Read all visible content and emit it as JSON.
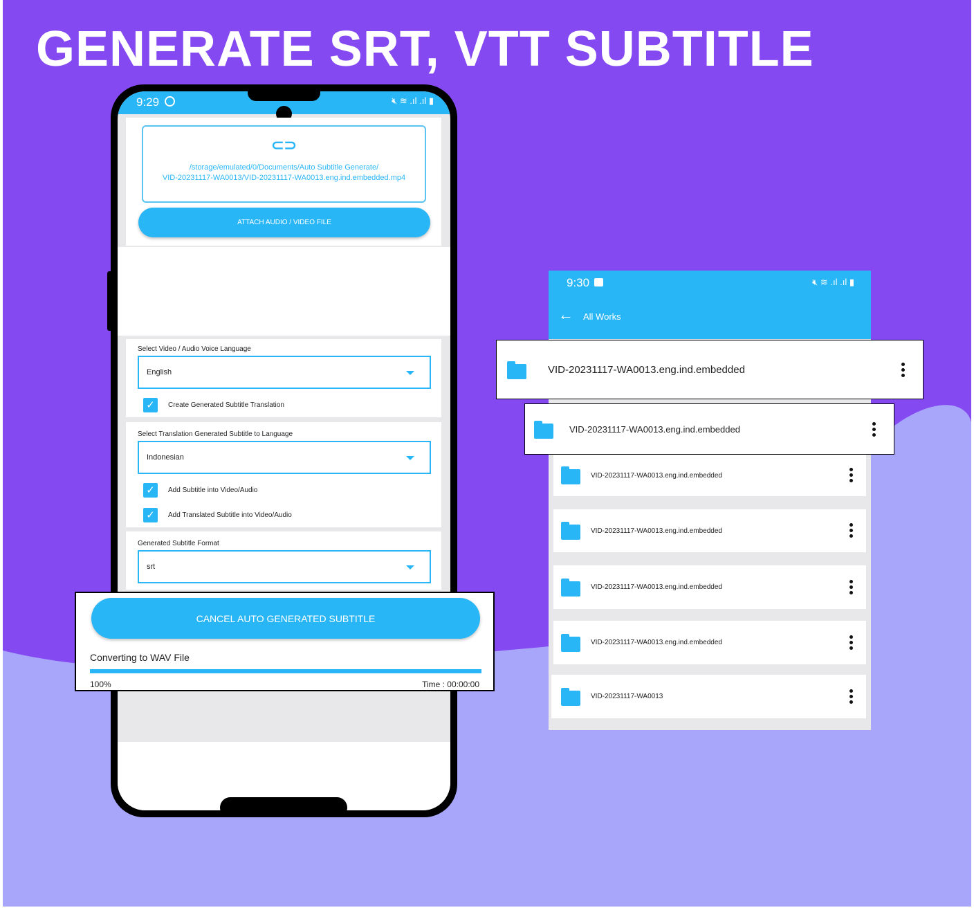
{
  "headline": "GENERATE SRT, VTT SUBTITLE",
  "colors": {
    "accent": "#29B6F6",
    "background_top": "#8549F2",
    "background_bottom": "#A8A6FB"
  },
  "phone1": {
    "time": "9:29",
    "file_path_line1": "/storage/emulated/0/Documents/Auto Subtitle Generate/",
    "file_path_line2": "VID-20231117-WA0013/VID-20231117-WA0013.eng.ind.embedded.mp4",
    "attach_button": "ATTACH AUDIO / VIDEO FILE",
    "voice_language_label": "Select Video / Audio Voice Language",
    "voice_language_value": "English",
    "create_translation_label": "Create Generated Subtitle Translation",
    "translation_language_label": "Select Translation Generated Subtitle to Language",
    "translation_language_value": "Indonesian",
    "add_subtitle_label": "Add Subtitle into Video/Audio",
    "add_translated_label": "Add Translated Subtitle into Video/Audio",
    "format_label": "Generated Subtitle Format",
    "format_value": "srt",
    "cancel_button": "CANCEL AUTO GENERATED SUBTITLE",
    "status_text": "Converting to WAV File",
    "progress_percent": 100,
    "progress_label": "100%",
    "time_label": "Time : 00:00:00"
  },
  "phone2": {
    "time": "9:30",
    "title": "All Works",
    "items": [
      "VID-20231117-WA0013.eng.ind.embedded",
      "VID-20231117-WA0013.eng.ind.embedded",
      "VID-20231117-WA0013.eng.ind.embedded",
      "VID-20231117-WA0013.eng.ind.embedded",
      "VID-20231117-WA0013.eng.ind.embedded",
      "VID-20231117-WA0013.eng.ind.embedded",
      "VID-20231117-WA0013"
    ]
  }
}
